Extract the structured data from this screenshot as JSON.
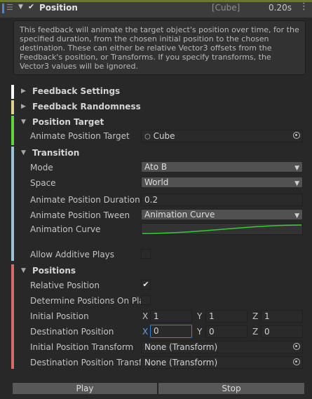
{
  "header": {
    "title": "Position",
    "target": "[Cube]",
    "duration": "0.20s",
    "enabled": true,
    "strip_color": "#4f86c6"
  },
  "help_text": "This feedback will animate the target object's position over time, for the specified duration, from the chosen initial position to the chosen destination. These can either be relative Vector3 offsets from the Feedback's position, or Transforms. If you specify transforms, the Vector3 values will be ignored.",
  "sections": {
    "feedback_settings": {
      "title": "Feedback Settings",
      "color": "#ffffff"
    },
    "feedback_randomness": {
      "title": "Feedback Randomness",
      "color": "#e0d28a"
    },
    "position_target": {
      "title": "Position Target",
      "color": "#5dd63a",
      "animate_position_target_label": "Animate Position Target",
      "animate_position_target_value": "Cube"
    },
    "transition": {
      "title": "Transition",
      "color": "#9ec2d6",
      "mode_label": "Mode",
      "mode_value": "Ato B",
      "space_label": "Space",
      "space_value": "World",
      "duration_label": "Animate Position Duration",
      "duration_value": "0.2",
      "tween_label": "Animate Position Tween",
      "tween_value": "Animation Curve",
      "curve_label": "Animation Curve",
      "curve_color": "#33cc33",
      "additive_label": "Allow Additive Plays",
      "additive_checked": false
    },
    "positions": {
      "title": "Positions",
      "color": "#d86a6a",
      "relative_label": "Relative Position",
      "relative_checked": true,
      "determine_label": "Determine Positions On Play",
      "determine_checked": false,
      "initial_label": "Initial Position",
      "initial": {
        "x": "1",
        "y": "1",
        "z": "1"
      },
      "destination_label": "Destination Position",
      "destination": {
        "x": "0",
        "y": "0",
        "z": "0"
      },
      "initial_transform_label": "Initial Position Transform",
      "initial_transform_value": "None (Transform)",
      "destination_transform_label": "Destination Position Transform",
      "destination_transform_value": "None (Transform)"
    }
  },
  "axes": {
    "x": "X",
    "y": "Y",
    "z": "Z"
  },
  "buttons": {
    "play": "Play",
    "stop": "Stop"
  }
}
